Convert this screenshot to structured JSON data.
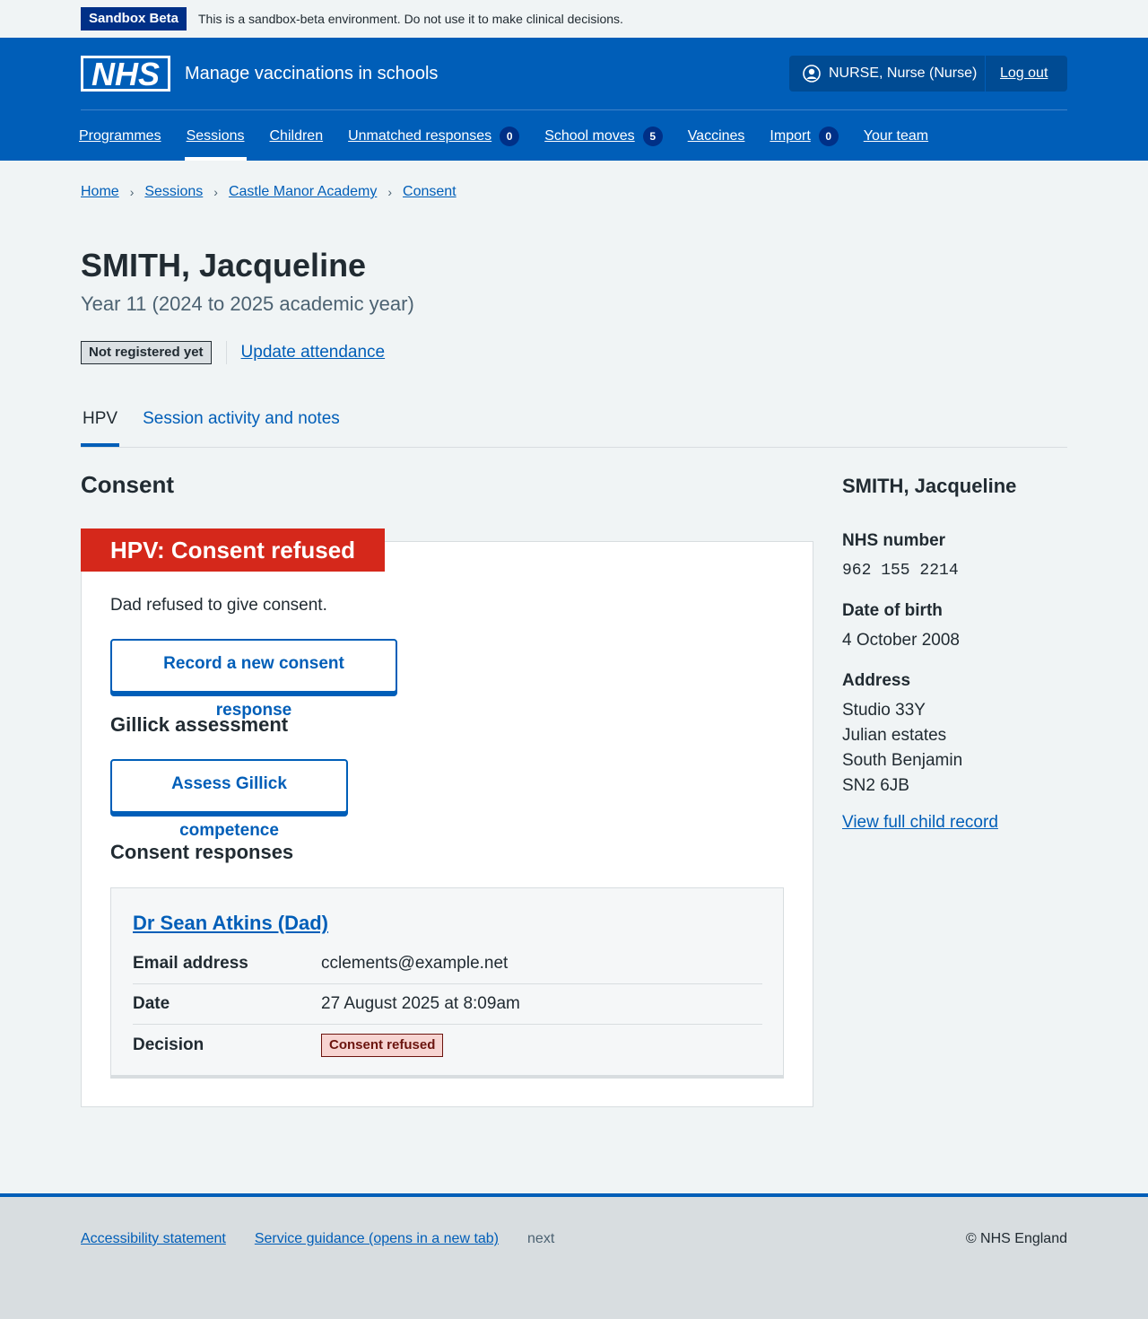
{
  "sandbox": {
    "tag": "Sandbox Beta",
    "text": "This is a sandbox-beta environment. Do not use it to make clinical decisions."
  },
  "header": {
    "logo_text": "NHS",
    "service_name": "Manage vaccinations in schools",
    "user": "NURSE, Nurse (Nurse)",
    "logout": "Log out"
  },
  "nav": {
    "items": [
      {
        "label": "Programmes",
        "count": null
      },
      {
        "label": "Sessions",
        "count": null,
        "active": true
      },
      {
        "label": "Children",
        "count": null
      },
      {
        "label": "Unmatched responses",
        "count": "0"
      },
      {
        "label": "School moves",
        "count": "5"
      },
      {
        "label": "Vaccines",
        "count": null
      },
      {
        "label": "Import",
        "count": "0"
      },
      {
        "label": "Your team",
        "count": null
      }
    ]
  },
  "breadcrumb": [
    "Home",
    "Sessions",
    "Castle Manor Academy",
    "Consent"
  ],
  "page": {
    "title": "SMITH, Jacqueline",
    "subtitle": "Year 11 (2024 to 2025 academic year)",
    "status_tag": "Not registered yet",
    "update_link": "Update attendance"
  },
  "tabs": [
    {
      "label": "HPV",
      "active": true
    },
    {
      "label": "Session activity and notes",
      "active": false
    }
  ],
  "main": {
    "section_title": "Consent",
    "card": {
      "heading": "HPV: Consent refused",
      "text": "Dad refused to give consent.",
      "record_button": "Record a new consent response",
      "gillick_heading": "Gillick assessment",
      "gillick_button": "Assess Gillick competence",
      "responses_heading": "Consent responses",
      "response": {
        "name": "Dr Sean Atkins (Dad)",
        "rows": [
          {
            "key": "Email address",
            "value": "cclements@example.net"
          },
          {
            "key": "Date",
            "value": "27 August 2025 at 8:09am"
          },
          {
            "key": "Decision",
            "value": "Consent refused"
          }
        ]
      }
    }
  },
  "sidebar": {
    "name": "SMITH, Jacqueline",
    "nhs_label": "NHS number",
    "nhs_value": "962 155 2214",
    "dob_label": "Date of birth",
    "dob_value": "4 October 2008",
    "address_label": "Address",
    "address_lines": [
      "Studio 33Y",
      "Julian estates",
      "South Benjamin",
      "SN2 6JB"
    ],
    "link": "View full child record"
  },
  "footer": {
    "links": [
      "Accessibility statement",
      "Service guidance (opens in a new tab)"
    ],
    "plain": "next",
    "copyright": "© NHS England"
  },
  "colors": {
    "nhs_blue": "#005eb8",
    "dark_blue": "#003087",
    "red": "#d5281b",
    "background": "#f0f4f5"
  }
}
